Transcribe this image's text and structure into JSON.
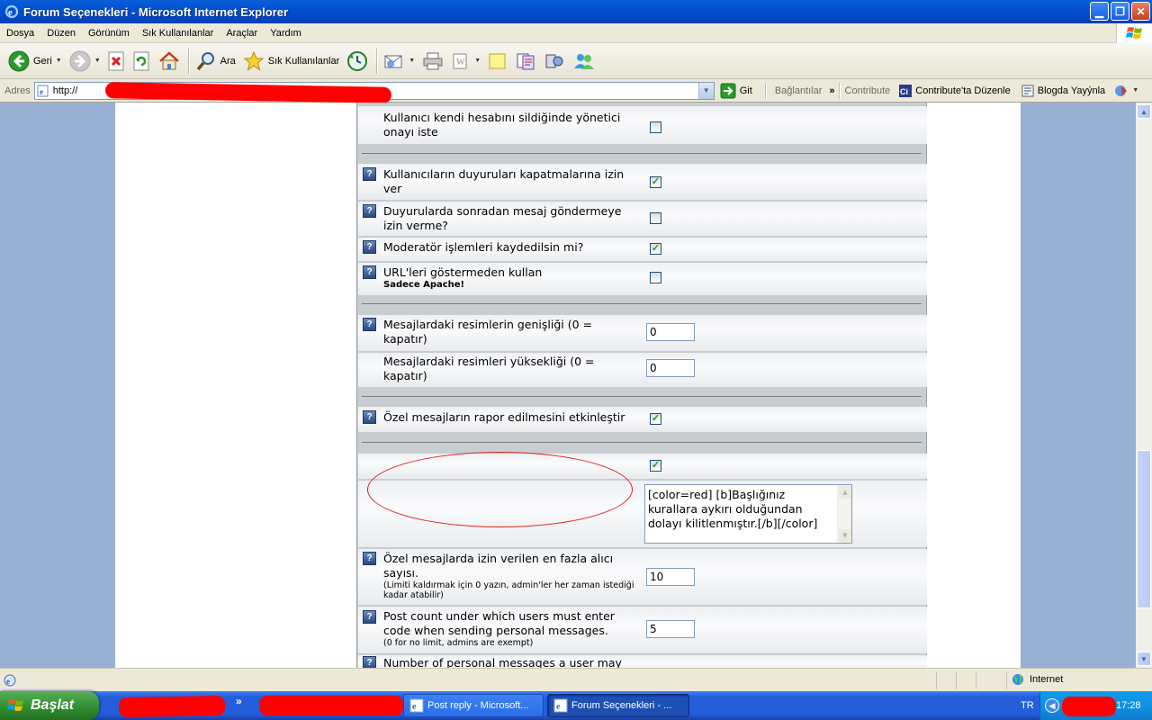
{
  "window": {
    "title": "Forum Seçenekleri - Microsoft Internet Explorer"
  },
  "menu": [
    "Dosya",
    "Düzen",
    "Görünüm",
    "Sık Kullanılanlar",
    "Araçlar",
    "Yardım"
  ],
  "toolbar": {
    "back": "Geri",
    "search": "Ara",
    "favorites": "Sık Kullanılanlar"
  },
  "address": {
    "label": "Adres",
    "url": "http://",
    "go": "Git",
    "links": "Bağlantılar",
    "contribute": "Contribute",
    "contribute_edit": "Contribute'ta Düzenle",
    "blog": "Blogda Yayýnla"
  },
  "rows": [
    {
      "label": "Kullanıcı kendi hesabını sildiğinde yönetici onayı iste",
      "checked": false
    },
    {
      "label": "Kullanıcıların duyuruları kapatmalarına izin ver",
      "checked": true
    },
    {
      "label": "Duyurularda sonradan mesaj göndermeye izin verme?",
      "checked": false
    },
    {
      "label": "Moderatör işlemleri kaydedilsin mi?",
      "checked": true
    },
    {
      "label": "URL'leri göstermeden kullan",
      "note": "Sadece Apache!",
      "checked": false
    },
    {
      "label": "Mesajlardaki resimlerin genişliği (0 = kapatır)",
      "value": "0"
    },
    {
      "label": "Mesajlardaki resimleri yüksekliği (0 = kapatır)",
      "value": "0"
    },
    {
      "label": "Özel mesajların rapor edilmesini etkinleştir",
      "checked": true
    },
    {
      "checked": true
    },
    {
      "textarea": "[color=red]  [b]Başlığınız kurallara aykırı olduğundan dolayı kilitlenmıştır.[/b][/color]"
    },
    {
      "label": "Özel mesajlarda izin verilen en fazla alıcı sayısı.",
      "note": "(Limiti kaldırmak için 0 yazın, admin'ler her zaman istediği kadar atabilir)",
      "value": "10"
    },
    {
      "label": "Post count under which users must enter code when sending personal messages.",
      "note": "(0 for no limit, admins are exempt)",
      "value": "5"
    },
    {
      "label": "Number of personal messages a user may"
    }
  ],
  "status": {
    "zone": "Internet"
  },
  "taskbar": {
    "start": "Başlat",
    "chevron": "»",
    "tasks": [
      "Post reply - Microsoft...",
      "Forum Seçenekleri - ..."
    ],
    "lang": "TR",
    "time": "17:28"
  }
}
